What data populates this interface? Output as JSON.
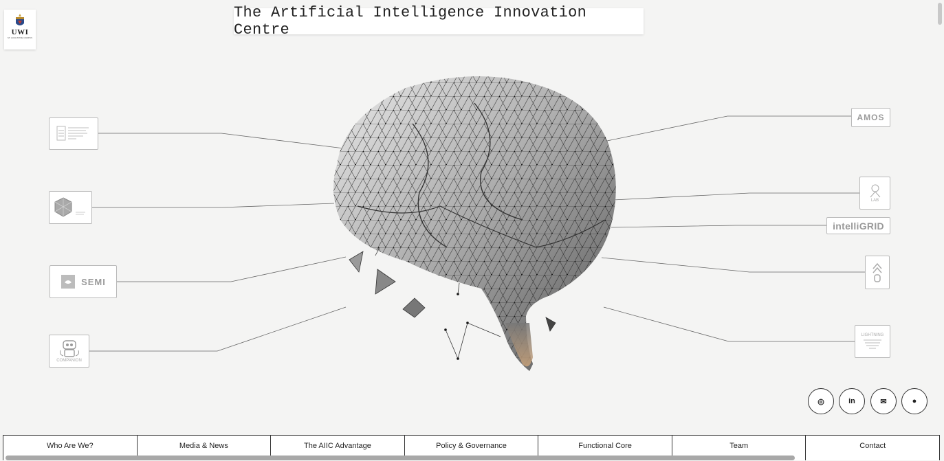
{
  "header": {
    "title": "The Artificial Intelligence Innovation Centre",
    "logo_text": "UWI",
    "logo_subtext": "ST. AUGUSTINE CAMPUS"
  },
  "left_cards": [
    {
      "name": "card-institute",
      "icon": "building-icon"
    },
    {
      "name": "card-cube",
      "icon": "hexagon-icon"
    },
    {
      "name": "card-semi",
      "label": "SEMI",
      "icon": "semi-icon"
    },
    {
      "name": "card-robot",
      "label": "COMPANION",
      "icon": "robot-icon"
    }
  ],
  "right_cards": [
    {
      "name": "card-amos",
      "label": "AMOS"
    },
    {
      "name": "card-lab",
      "label": "LAB",
      "icon": "lab-icon"
    },
    {
      "name": "card-intelligrid",
      "label": "intelliGRID"
    },
    {
      "name": "card-chevron",
      "icon": "chevron-up-icon"
    },
    {
      "name": "card-lightning",
      "label": "LIGHTNING",
      "icon": "brain-lines-icon"
    }
  ],
  "social": [
    {
      "icon": "instagram-icon",
      "glyph": "◎"
    },
    {
      "icon": "linkedin-icon",
      "glyph": "in"
    },
    {
      "icon": "mail-icon",
      "glyph": "✉"
    },
    {
      "icon": "github-icon",
      "glyph": "●"
    }
  ],
  "nav": [
    "Who Are We?",
    "Media & News",
    "The AIIC Advantage",
    "Policy & Governance",
    "Functional Core",
    "Team",
    "Contact"
  ],
  "colors": {
    "background": "#f4f4f3",
    "border": "#333333",
    "card_border": "#b9b9b9"
  }
}
